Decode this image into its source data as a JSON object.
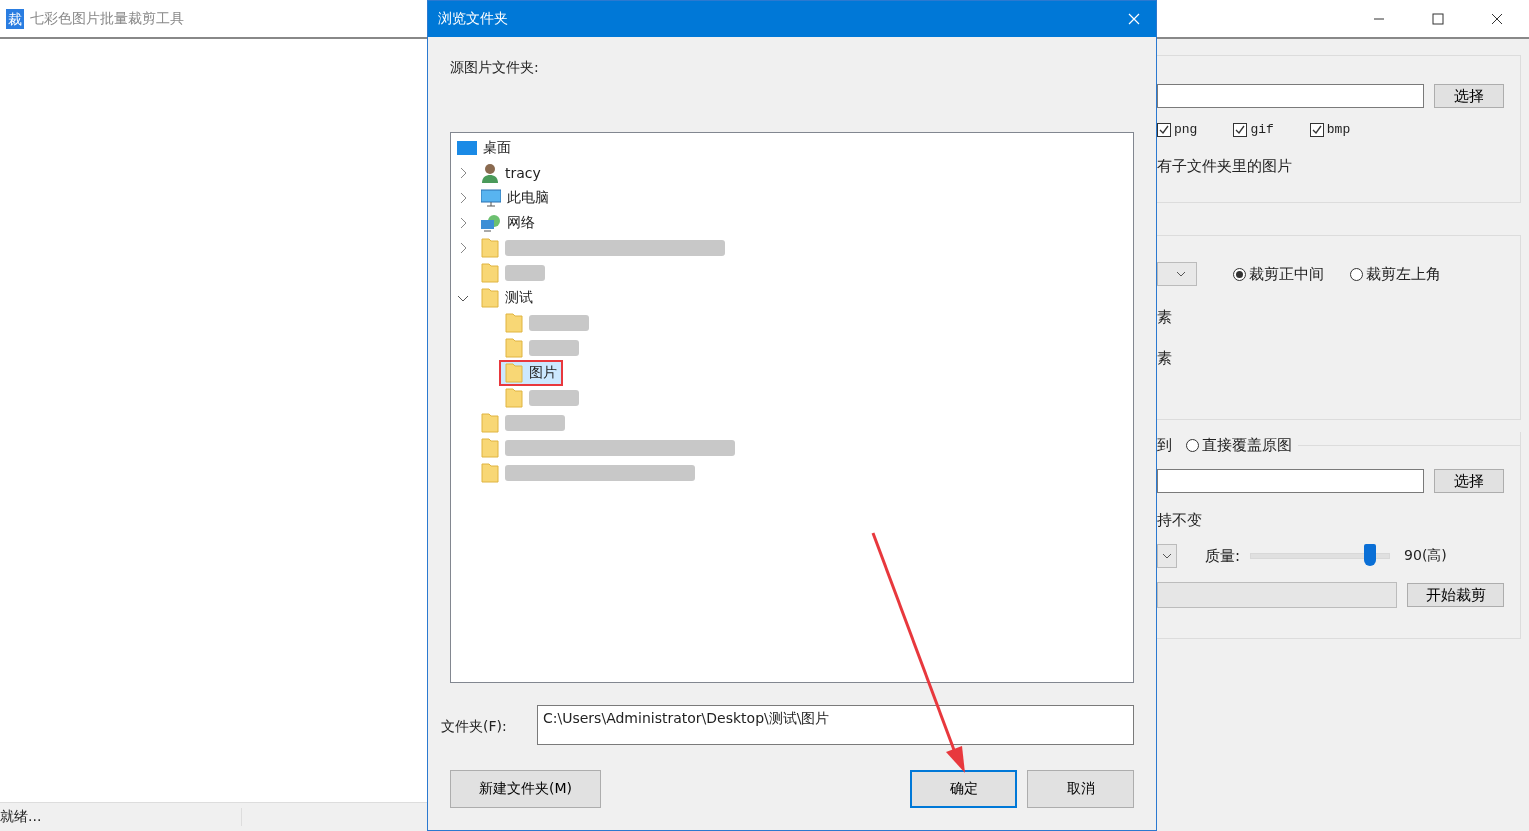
{
  "app": {
    "icon_text": "裁",
    "title": "七彩色图片批量裁剪工具"
  },
  "source": {
    "button": "选择",
    "types": [
      {
        "label": "png",
        "checked": true
      },
      {
        "label": "gif",
        "checked": true
      },
      {
        "label": "bmp",
        "checked": true
      }
    ],
    "subfolders_text": "有子文件夹里的图片"
  },
  "crop": {
    "modes": [
      {
        "label": "裁剪正中间",
        "selected": true
      },
      {
        "label": "裁剪左上角",
        "selected": false
      }
    ],
    "width_unit": "素",
    "height_unit": "素"
  },
  "output": {
    "label_tail": "到",
    "overwrite": {
      "label": "直接覆盖原图",
      "selected": false
    },
    "button": "选择",
    "keep_text": "持不变",
    "quality_label": "质量:",
    "quality": {
      "level": 0.86
    },
    "quality_reading": "90(高)",
    "progress": {
      "level": 0
    },
    "start_button": "开始裁剪"
  },
  "status_bar": {
    "text": "就绪..."
  },
  "dialog": {
    "title": "浏览文件夹",
    "prompt": "源图片文件夹:",
    "tree": [
      {
        "kind": "desktop",
        "label": "桌面",
        "selected": false,
        "children": [
          {
            "kind": "user",
            "label": "tracy",
            "expanded": false,
            "selected": false
          },
          {
            "kind": "computer",
            "label": "此电脑",
            "expanded": false,
            "selected": false
          },
          {
            "kind": "network",
            "label": "网络",
            "expanded": false,
            "selected": false
          },
          {
            "kind": "folder",
            "expanded": false,
            "selected": false
          },
          {
            "kind": "folder",
            "selected": false
          },
          {
            "kind": "folder",
            "label": "测试",
            "expanded": true,
            "selected": false,
            "children": [
              {
                "kind": "folder",
                "selected": false
              },
              {
                "kind": "folder",
                "selected": false
              },
              {
                "kind": "folder",
                "label": "图片",
                "selected": true
              },
              {
                "kind": "folder",
                "selected": false
              }
            ]
          },
          {
            "kind": "folder",
            "selected": false
          },
          {
            "kind": "folder",
            "selected": false
          },
          {
            "kind": "folder",
            "selected": false
          }
        ]
      }
    ],
    "folder_label": "文件夹(F):",
    "folder_value": "C:\\Users\\Administrator\\Desktop\\测试\\图片",
    "buttons": [
      {
        "label": "新建文件夹(M)",
        "default": false
      },
      {
        "label": "确定",
        "default": true
      },
      {
        "label": "取消",
        "default": false
      }
    ]
  }
}
